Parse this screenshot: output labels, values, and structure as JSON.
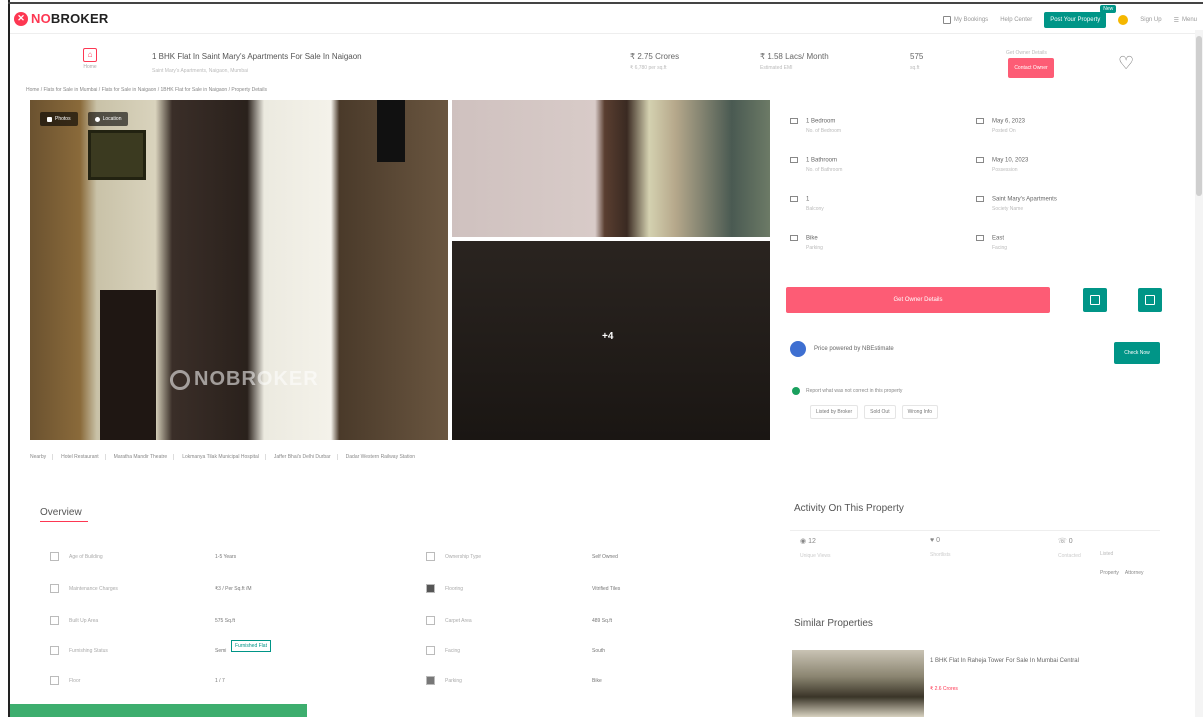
{
  "header": {
    "logo_text_a": "NO",
    "logo_text_b": "BROKER",
    "items": [
      "My Bookings",
      "Help Center"
    ],
    "post_button": "Post Your Property",
    "new_badge": "New",
    "login": "Sign Up",
    "menu": "Menu"
  },
  "title": {
    "home_label": "Home",
    "heading": "1 BHK Flat In Saint Mary's Apartments For Sale In Naigaon",
    "subheading": "Saint Mary's Apartments, Naigaon, Mumbai",
    "price_label": "₹ 2.75 Crores",
    "price_sub": "₹ 6,780 per sq.ft",
    "emi_label": "₹ 1.58 Lacs/ Month",
    "emi_sub": "Estimated EMI",
    "area_label": "575",
    "area_sub": "sq.ft",
    "contact_hint": "Get Owner Details",
    "contact_button": "Contact Owner"
  },
  "breadcrumb": "Home  /  Flats for Sale in Mumbai  /  Flats for Sale in Naigaon  /  1BHK Flat for Sale in Naigaon  /  Property Details",
  "gallery": {
    "tab_photos": "Photos",
    "tab_location": "Location",
    "watermark": "NOBROKER",
    "more_count": "+4"
  },
  "nearby": [
    "Nearby",
    "Hotel Restaurant",
    "Maratha Mandir Theatre",
    "Lokmanya Tilak Municipal Hospital",
    "Jaffer Bhai's Delhi Durbar",
    "Dadar Western Railway Station"
  ],
  "facts": [
    {
      "label": "1 Bedroom",
      "sub": "No. of Bedroom"
    },
    {
      "label": "May 6, 2023",
      "sub": "Posted On"
    },
    {
      "label": "1 Bathroom",
      "sub": "No. of Bathroom"
    },
    {
      "label": "May 10, 2023",
      "sub": "Possession"
    },
    {
      "label": "1",
      "sub": "Balcony"
    },
    {
      "label": "Saint Mary's Apartments",
      "sub": "Society Name"
    },
    {
      "label": "Bike",
      "sub": "Parking"
    },
    {
      "label": "East",
      "sub": "Facing"
    }
  ],
  "owner_button": "Get Owner Details",
  "estimate": {
    "text": "Price powered by NBEstimate",
    "button": "Check Now"
  },
  "report": {
    "text": "Report what was not correct in this property",
    "chips": [
      "Listed by Broker",
      "Sold Out",
      "Wrong Info"
    ]
  },
  "overview": {
    "title": "Overview",
    "left": [
      {
        "label": "Age of Building",
        "value": "1-5 Years"
      },
      {
        "label": "Maintenance Charges",
        "value": "₹3 / Per Sq.ft /M"
      },
      {
        "label": "Built Up Area",
        "value": "575 Sq.ft"
      },
      {
        "label": "Furnishing Status",
        "value": "Semi"
      },
      {
        "label": "Floor",
        "value": "1 / 7"
      }
    ],
    "furnish_tag": "Furnished Flat",
    "right": [
      {
        "label": "Ownership Type",
        "value": "Self Owned"
      },
      {
        "label": "Flooring",
        "value": "Vitrified Tiles"
      },
      {
        "label": "Carpet Area",
        "value": "489 Sq.ft"
      },
      {
        "label": "Facing",
        "value": "South"
      },
      {
        "label": "Parking",
        "value": "Bike"
      }
    ]
  },
  "activity": {
    "title": "Activity On This Property",
    "stats": [
      {
        "value": "12",
        "sub": "Unique Views"
      },
      {
        "value": "0",
        "sub": "Shortlists"
      },
      {
        "value": "0",
        "sub": "Contacted"
      }
    ],
    "share_label": "Listed",
    "share_links": [
      "Property",
      "Attorney"
    ]
  },
  "similar": {
    "title": "Similar Properties",
    "item_text": "1 BHK Flat In Raheja Tower For Sale In Mumbai Central",
    "item_sub": "₹ 2.6 Crores"
  },
  "colors": {
    "brand": "#fd3752",
    "accent": "#009587",
    "cta": "#fd5c75"
  }
}
